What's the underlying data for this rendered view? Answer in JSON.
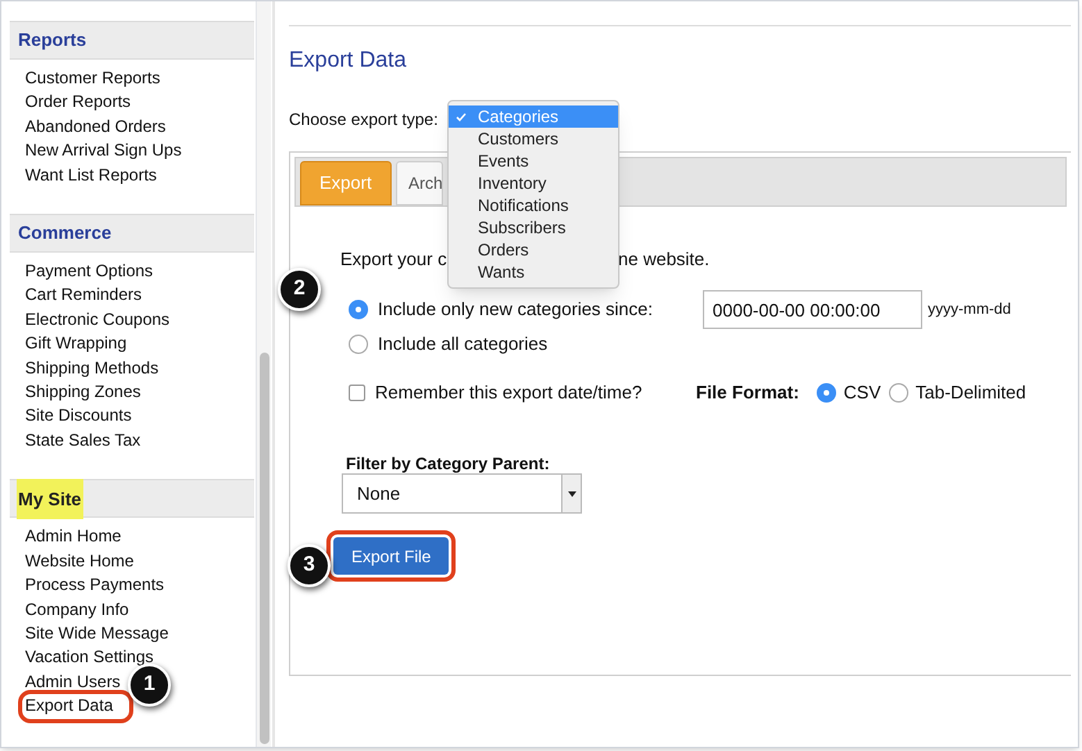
{
  "sidebar": {
    "sections": [
      {
        "title": "Reports",
        "highlighted": false,
        "items": [
          {
            "label": "Customer Reports",
            "circled": false
          },
          {
            "label": "Order Reports",
            "circled": false
          },
          {
            "label": "Abandoned Orders",
            "circled": false
          },
          {
            "label": "New Arrival Sign Ups",
            "circled": false
          },
          {
            "label": "Want List Reports",
            "circled": false
          }
        ]
      },
      {
        "title": "Commerce",
        "highlighted": false,
        "items": [
          {
            "label": "Payment Options",
            "circled": false
          },
          {
            "label": "Cart Reminders",
            "circled": false
          },
          {
            "label": "Electronic Coupons",
            "circled": false
          },
          {
            "label": "Gift Wrapping",
            "circled": false
          },
          {
            "label": "Shipping Methods",
            "circled": false
          },
          {
            "label": "Shipping Zones",
            "circled": false
          },
          {
            "label": "Site Discounts",
            "circled": false
          },
          {
            "label": "State Sales Tax",
            "circled": false
          }
        ]
      },
      {
        "title": "My Site",
        "highlighted": true,
        "items": [
          {
            "label": "Admin Home",
            "circled": false
          },
          {
            "label": "Website Home",
            "circled": false
          },
          {
            "label": "Process Payments",
            "circled": false
          },
          {
            "label": "Company Info",
            "circled": false
          },
          {
            "label": "Site Wide Message",
            "circled": false
          },
          {
            "label": "Vacation Settings",
            "circled": false
          },
          {
            "label": "Admin Users",
            "circled": false
          },
          {
            "label": "Export Data",
            "circled": true
          }
        ]
      }
    ]
  },
  "page_title": "Export Data",
  "export_type": {
    "label": "Choose export type:",
    "options": [
      {
        "label": "Categories",
        "selected": true
      },
      {
        "label": "Customers",
        "selected": false
      },
      {
        "label": "Events",
        "selected": false
      },
      {
        "label": "Inventory",
        "selected": false
      },
      {
        "label": "Notifications",
        "selected": false
      },
      {
        "label": "Subscribers",
        "selected": false
      },
      {
        "label": "Orders",
        "selected": false
      },
      {
        "label": "Wants",
        "selected": false
      }
    ]
  },
  "tabs": [
    {
      "label": "Export",
      "selected": true
    },
    {
      "label": "Arch",
      "selected": false
    }
  ],
  "intro": [
    "Export your c",
    "ne website."
  ],
  "range_options": [
    {
      "label": "Include only new categories since:",
      "selected": true
    },
    {
      "label": "Include all categories",
      "selected": false
    }
  ],
  "since_field": {
    "value": "0000-00-00 00:00:00",
    "hint": "yyyy-mm-dd"
  },
  "remember": {
    "label": "Remember this export date/time?",
    "checked": false
  },
  "file_format": {
    "label": "File Format:",
    "options": [
      {
        "label": "CSV",
        "selected": true
      },
      {
        "label": "Tab-Delimited",
        "selected": false
      }
    ]
  },
  "filter": {
    "label": "Filter by Category Parent:",
    "value": "None"
  },
  "export_button": {
    "label": "Export File",
    "circled": true
  },
  "annotations": [
    {
      "number": "1"
    },
    {
      "number": "2"
    },
    {
      "number": "3"
    }
  ]
}
